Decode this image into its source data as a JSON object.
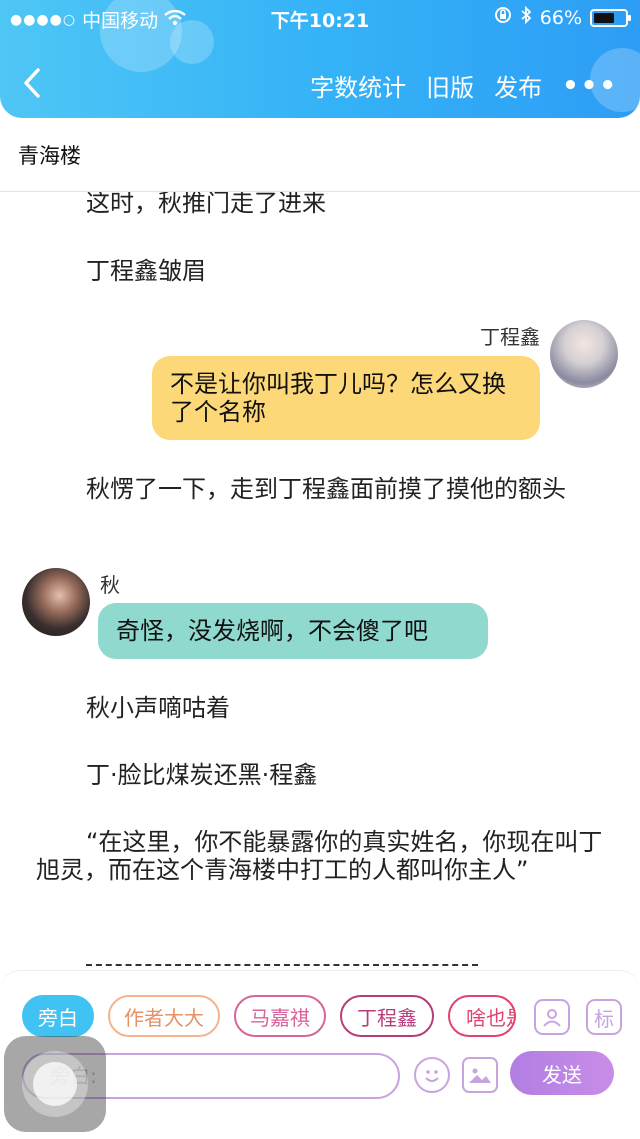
{
  "status_bar": {
    "carrier": "中国移动",
    "time": "下午10:21",
    "battery": "66%",
    "battery_level": 0.66,
    "signal_icon": "signal-dots-icon",
    "wifi_icon": "wifi-icon",
    "lock_icon": "orientation-lock-icon",
    "bluetooth_icon": "bluetooth-icon"
  },
  "nav": {
    "back_icon": "chevron-left-icon",
    "word_count": "字数统计",
    "old_version": "旧版",
    "publish": "发布",
    "more_icon": "more-dots-icon"
  },
  "chapter": {
    "title": "青海楼"
  },
  "story": {
    "p1": "这时，秋推门走了进来",
    "p2": "丁程鑫皱眉",
    "msg1": {
      "speaker": "丁程鑫",
      "text": "不是让你叫我丁儿吗？怎么又换了个名称"
    },
    "p3": "秋愣了一下，走到丁程鑫面前摸了摸他的额头",
    "msg2": {
      "speaker": "秋",
      "text": "奇怪，没发烧啊，不会傻了吧"
    },
    "p4": "秋小声嘀咕着",
    "p5": "丁·脸比煤炭还黑·程鑫",
    "p6": "“在这里，你不能暴露你的真实姓名，你现在叫丁旭灵，而在这个青海楼中打工的人都叫你主人”"
  },
  "composer": {
    "roles": [
      "旁白",
      "作者大大",
      "马嘉祺",
      "丁程鑫",
      "啥也是"
    ],
    "role_icon": "person-card-icon",
    "tag_label": "标",
    "input_placeholder": "旁白:",
    "emoji_icon": "smiley-icon",
    "image_icon": "image-icon",
    "send": "发送"
  },
  "colors": {
    "header_start": "#4fc6f5",
    "header_end": "#2d9df5",
    "yellow_bubble": "#fcd879",
    "teal_bubble": "#8fd9cf",
    "accent_purple": "#c7a4df"
  }
}
